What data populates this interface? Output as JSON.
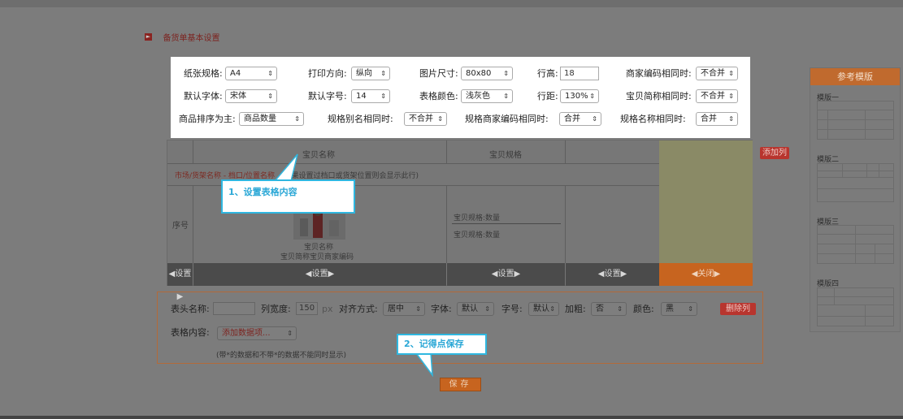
{
  "section_title": "备货单基本设置",
  "settings": {
    "paper_label": "纸张规格:",
    "paper_value": "A4",
    "direction_label": "打印方向:",
    "direction_value": "纵向",
    "image_size_label": "图片尺寸:",
    "image_size_value": "80x80",
    "row_height_label": "行高:",
    "row_height_value": "18",
    "merchant_code_label": "商家编码相同时:",
    "merchant_code_value": "不合并",
    "font_label": "默认字体:",
    "font_value": "宋体",
    "font_size_label": "默认字号:",
    "font_size_value": "14",
    "table_color_label": "表格颜色:",
    "table_color_value": "浅灰色",
    "spacing_label": "行距:",
    "spacing_value": "130%",
    "short_name_label": "宝贝简称相同时:",
    "short_name_value": "不合并",
    "sort_label": "商品排序为主:",
    "sort_value": "商品数量",
    "alias_label": "规格别名相同时:",
    "alias_value": "不合并",
    "spec_merchant_label": "规格商家编码相同时:",
    "spec_merchant_value": "合并",
    "spec_name_label": "规格名称相同时:",
    "spec_name_value": "合并"
  },
  "table": {
    "col_product_name": "宝贝名称",
    "col_product_spec": "宝贝规格",
    "market_row_red": "市场/货架名称 - 档口/位置名称",
    "market_row_note": "(如果设置过档口或货架位置则会显示此行)",
    "seq_label": "序号",
    "product_name": "宝贝名称",
    "product_short_code": "宝贝简称宝贝商家编码",
    "spec_qty_1": "宝贝规格:数量",
    "spec_qty_2": "宝贝规格:数量",
    "setting_small": "设置",
    "setting_1": "设置",
    "setting_2": "设置",
    "setting_3": "设置",
    "close_label": "关闭"
  },
  "add_column_label": "添加列",
  "column_config": {
    "header_name_label": "表头名称:",
    "header_name_value": "",
    "col_width_label": "列宽度:",
    "col_width_value": "150",
    "col_width_unit": "px",
    "align_label": "对齐方式:",
    "align_value": "居中",
    "font_label": "字体:",
    "font_value": "默认",
    "font_size_label": "字号:",
    "font_size_value": "默认",
    "bold_label": "加粗:",
    "bold_value": "否",
    "color_label": "颜色:",
    "color_value": "黑",
    "delete_label": "删除列",
    "content_label": "表格内容:",
    "content_value": "添加数据项...",
    "content_note": "(带*的数据和不带*的数据不能同时显示)"
  },
  "save_label": "保存",
  "templates": {
    "title": "参考模版",
    "items": [
      "模版一",
      "模版二",
      "模版三",
      "模版四"
    ]
  },
  "tips": {
    "tip1": "1、设置表格内容",
    "tip2": "2、记得点保存"
  },
  "colors": {
    "accent_orange": "#c7641f",
    "tip_blue": "#2fb7e0",
    "danger_red": "#b8352e"
  }
}
